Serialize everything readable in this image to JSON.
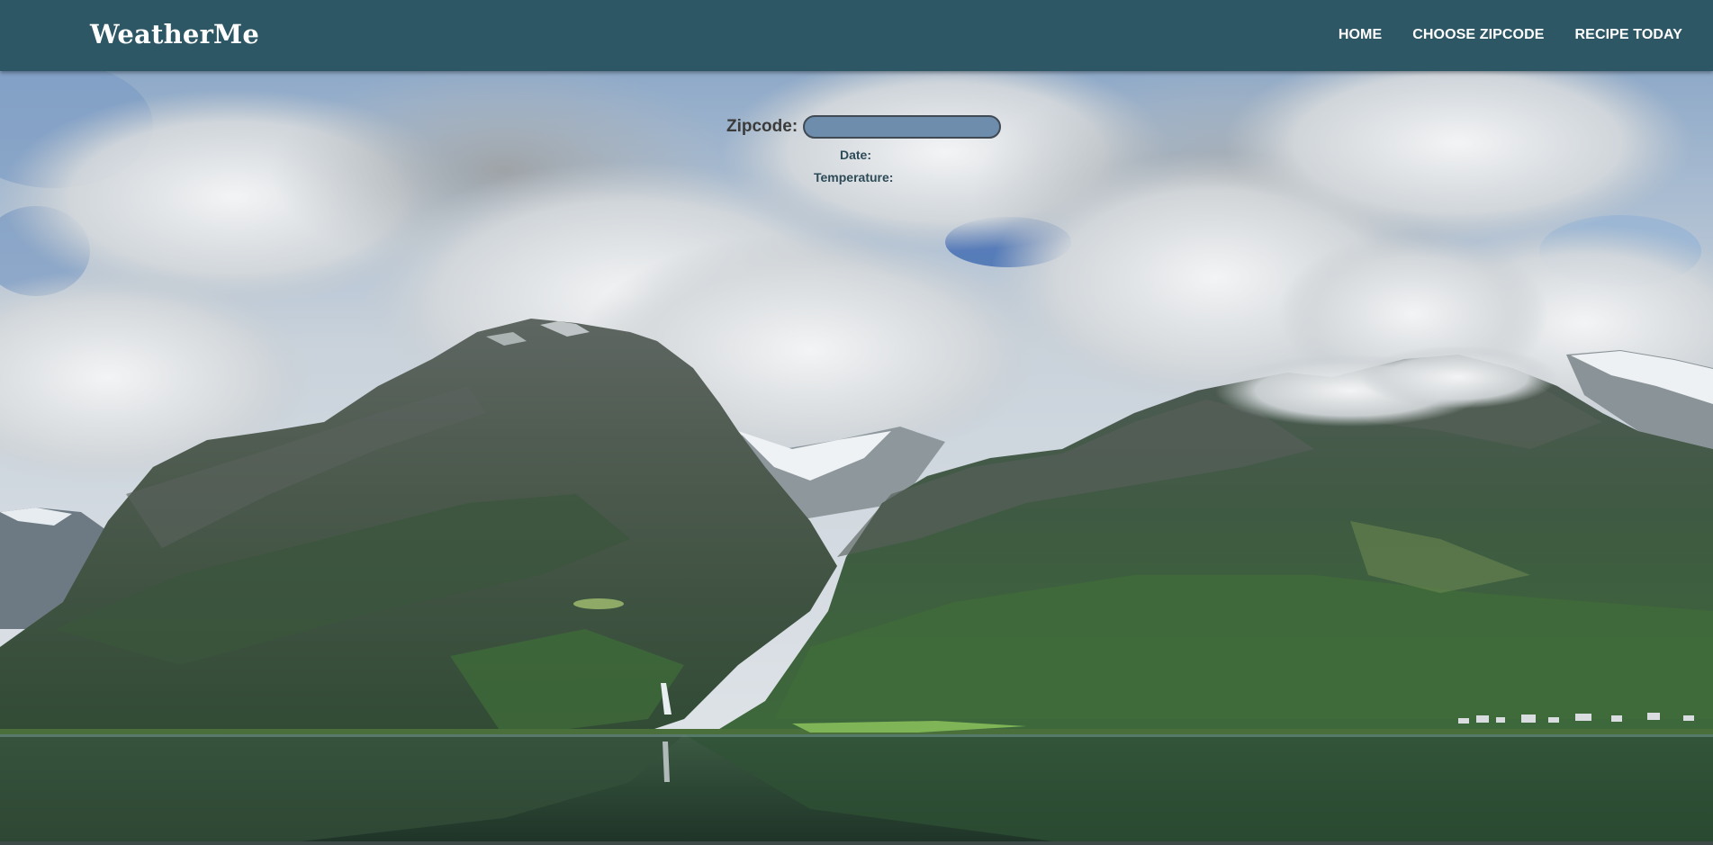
{
  "header": {
    "brand": "WeatherMe",
    "nav": [
      {
        "label": "HOME"
      },
      {
        "label": "CHOOSE ZIPCODE"
      },
      {
        "label": "RECIPE TODAY"
      }
    ]
  },
  "form": {
    "zip_label": "Zipcode:",
    "zip_value": "",
    "zip_placeholder": ""
  },
  "weather": {
    "date_label": "Date:",
    "temperature_label": "Temperature:"
  },
  "colors": {
    "navbar": "#2e5765",
    "input_fill": "#6e8cab",
    "info_text": "#2d4a57"
  }
}
